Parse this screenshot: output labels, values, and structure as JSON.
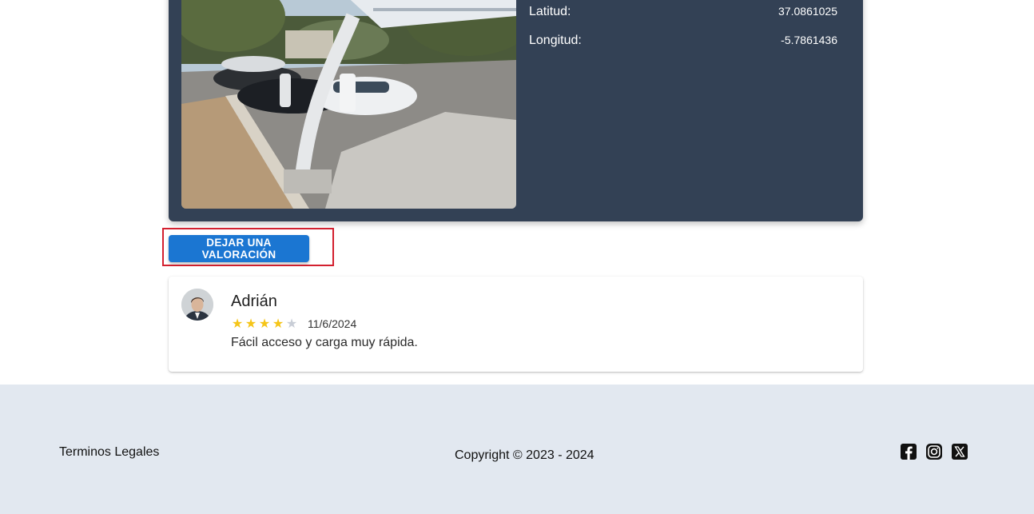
{
  "station": {
    "latitude_label": "Latitud:",
    "latitude_value": "37.0861025",
    "longitude_label": "Longitud:",
    "longitude_value": "-5.7861436"
  },
  "actions": {
    "rate_button_label": "DEJAR UNA VALORACIÓN"
  },
  "reviews": [
    {
      "name": "Adrián",
      "rating": 4,
      "max_rating": 5,
      "date": "11/6/2024",
      "text": "Fácil acceso y carga muy rápida."
    }
  ],
  "footer": {
    "legal_link": "Terminos Legales",
    "copyright": "Copyright © 2023 - 2024",
    "social_icons": [
      "facebook-icon",
      "instagram-icon",
      "x-twitter-icon"
    ]
  },
  "colors": {
    "card_background": "#334155",
    "primary_button": "#1b76d2",
    "highlight_outline": "#d3202f",
    "star_filled": "#f5c518",
    "star_empty": "#c8cdd6",
    "footer_background": "#e2e8f0"
  }
}
